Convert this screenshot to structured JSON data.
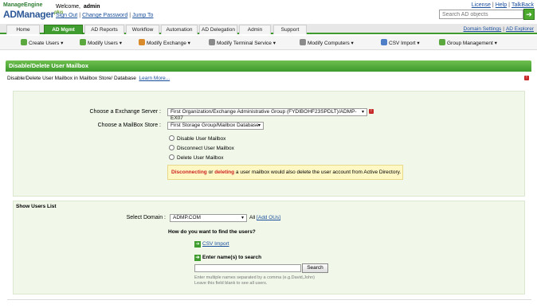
{
  "brand": {
    "line1": "ManageEngine",
    "line2": "ADManager",
    "plus": "plus"
  },
  "welcome": {
    "prefix": "Welcome,",
    "user": "admin"
  },
  "user_links": [
    "Sign Out",
    "Change Password",
    "Jump To"
  ],
  "top_links": [
    "License",
    "Help",
    "TalkBack"
  ],
  "search": {
    "placeholder": "Search AD objects"
  },
  "tabs": [
    "Home",
    "AD Mgmt",
    "AD Reports",
    "Workflow",
    "Automation",
    "AD Delegation",
    "Admin",
    "Support"
  ],
  "active_tab": "AD Mgmt",
  "nav_right": [
    "Domain Settings",
    "AD Explorer"
  ],
  "subnav": [
    "Create Users",
    "Modify Users",
    "Modify Exchange",
    "Modify Terminal Service",
    "Modify Computers",
    "CSV Import",
    "Group Management"
  ],
  "page": {
    "title": "Disable/Delete User Mailbox",
    "description": "Disable/Delete User Mailbox in Mailbox Store/ Database",
    "learn_more": "Learn More..."
  },
  "form": {
    "exchange_label": "Choose a Exchange Server :",
    "exchange_value": "First Organization/Exchange Administrative Group (FYDIBOHF23SPDLT)/ADMP-EX07",
    "mailbox_label": "Choose a MailBox Store :",
    "mailbox_value": "First Storage Group/Mailbox Database",
    "options": [
      "Disable User Mailbox",
      "Disconnect User Mailbox",
      "Delete User Mailbox"
    ],
    "warning": {
      "w1": "Disconnecting",
      "w2": " or ",
      "w3": "deleting",
      "w4": " a user mailbox would also delete the user account from Active Directory."
    }
  },
  "users": {
    "section_title": "Show Users List",
    "domain_label": "Select Domain :",
    "domain_value": "ADMP.COM",
    "all_text": "All",
    "add_ous": "[Add OUs]",
    "how_find": "How do you want to find the users?",
    "csv_import": "CSV Import",
    "enter_names": "Enter name(s) to search",
    "search_button": "Search",
    "hint1": "Enter multiple names separated by a comma (e.g.David,John)",
    "hint2": "Leave this field blank to see all users."
  }
}
